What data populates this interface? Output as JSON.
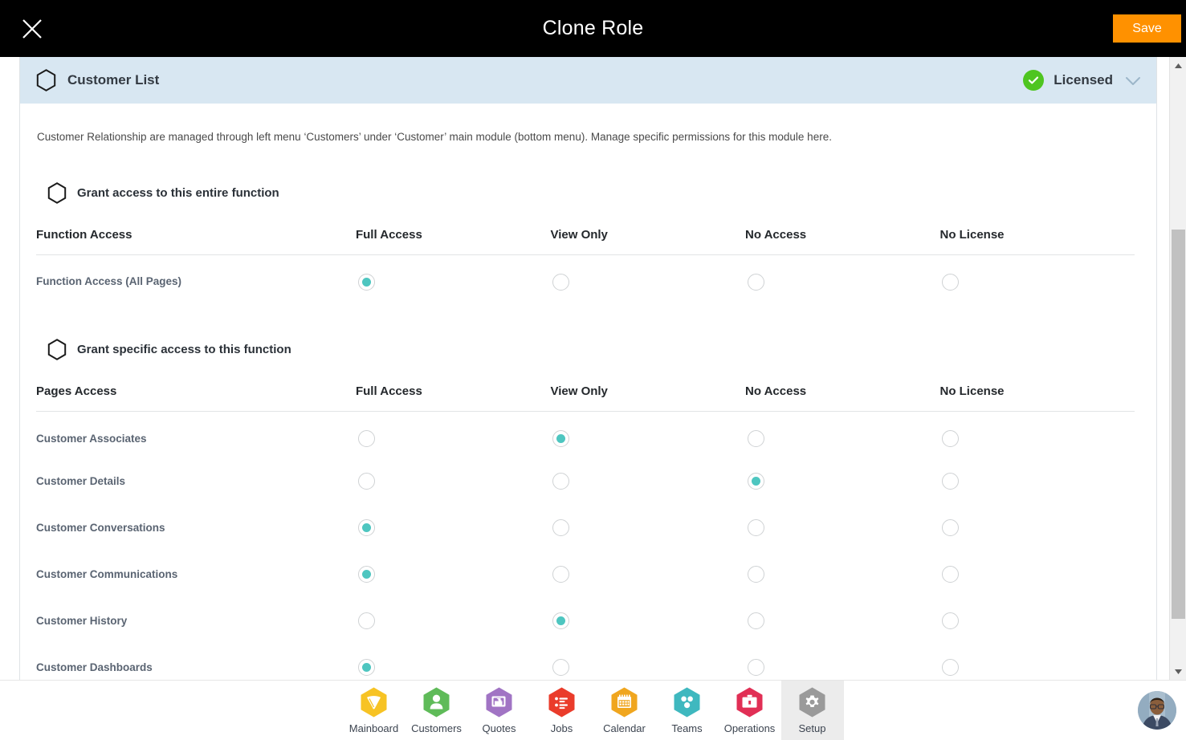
{
  "topbar": {
    "title": "Clone Role",
    "close_label": "Close",
    "save_label": "Save"
  },
  "section": {
    "title": "Customer List",
    "license_status": "Licensed",
    "description": "Customer Relationship are managed through left menu ‘Customers’ under ‘Customer’ main module (bottom menu). Manage specific permissions for this module here."
  },
  "entire_function": {
    "heading": "Grant access to this entire function",
    "columns": [
      "Function Access",
      "Full Access",
      "View Only",
      "No Access",
      "No License"
    ],
    "rows": [
      {
        "label": "Function Access (All Pages)",
        "selected": 0
      }
    ]
  },
  "specific_function": {
    "heading": "Grant specific access to this function",
    "columns": [
      "Pages Access",
      "Full Access",
      "View Only",
      "No Access",
      "No License"
    ],
    "rows": [
      {
        "label": "Customer Associates",
        "selected": 1
      },
      {
        "label": "Customer Details",
        "selected": 2
      },
      {
        "label": "Customer Conversations",
        "selected": 0
      },
      {
        "label": "Customer Communications",
        "selected": 0
      },
      {
        "label": "Customer History",
        "selected": 1
      },
      {
        "label": "Customer Dashboards",
        "selected": 0
      }
    ]
  },
  "bottom_nav": {
    "items": [
      {
        "label": "Mainboard",
        "icon": "mainboard-icon",
        "color": "#f7c324",
        "active": false
      },
      {
        "label": "Customers",
        "icon": "person-icon",
        "color": "#5fbb59",
        "active": false
      },
      {
        "label": "Quotes",
        "icon": "quotes-icon",
        "color": "#a174c4",
        "active": false
      },
      {
        "label": "Jobs",
        "icon": "list-icon",
        "color": "#ea3c2b",
        "active": false
      },
      {
        "label": "Calendar",
        "icon": "calendar-icon",
        "color": "#f0a61f",
        "active": false
      },
      {
        "label": "Teams",
        "icon": "teams-icon",
        "color": "#3fb8bf",
        "active": false
      },
      {
        "label": "Operations",
        "icon": "briefcase-icon",
        "color": "#e12f55",
        "active": false
      },
      {
        "label": "Setup",
        "icon": "gear-icon",
        "color": "#9a9a9a",
        "active": true
      }
    ]
  },
  "colors": {
    "accent_orange": "#ff9100",
    "radio_selected": "#4ec6c0",
    "license_green": "#4ec520",
    "section_header_bg": "#d8e7f2"
  },
  "scrollbar": {
    "up_arrow": "scroll-up",
    "down_arrow": "scroll-down"
  },
  "user": {
    "avatar_label": "User avatar"
  }
}
